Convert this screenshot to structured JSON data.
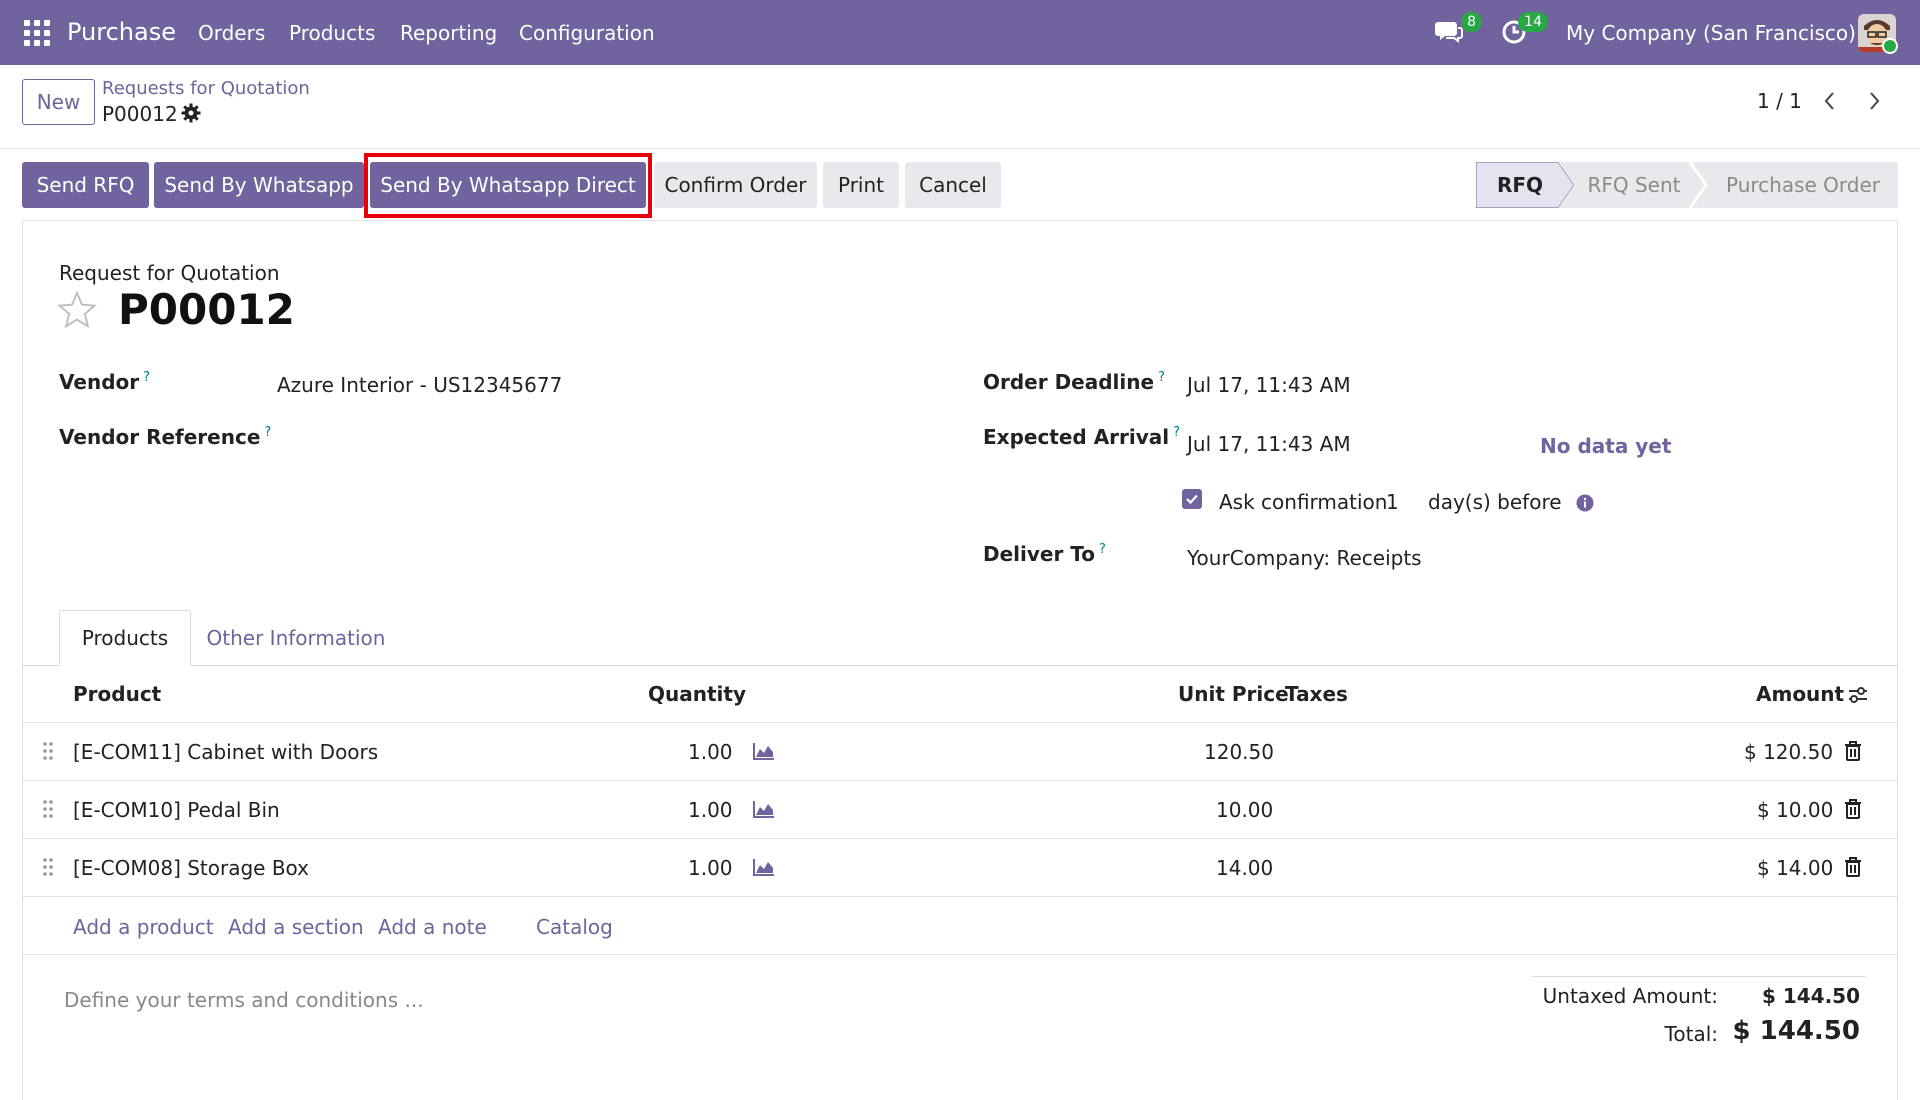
{
  "navbar": {
    "app_name": "Purchase",
    "menu": [
      "Orders",
      "Products",
      "Reporting",
      "Configuration"
    ],
    "messages_count": "8",
    "activities_count": "14",
    "company": "My Company (San Francisco)",
    "accent_color": "#71639e"
  },
  "control_panel": {
    "new_label": "New",
    "breadcrumb": "Requests for Quotation",
    "record_name": "P00012",
    "pager": "1 / 1"
  },
  "actions": {
    "send_rfq": "Send RFQ",
    "send_whatsapp": "Send By Whatsapp",
    "send_whatsapp_direct": "Send By Whatsapp Direct",
    "confirm_order": "Confirm Order",
    "print": "Print",
    "cancel": "Cancel"
  },
  "statusbar": {
    "steps": [
      "RFQ",
      "RFQ Sent",
      "Purchase Order"
    ],
    "active": "RFQ"
  },
  "form": {
    "doc_type": "Request for Quotation",
    "title": "P00012",
    "vendor_label": "Vendor",
    "vendor_value": "Azure Interior - US12345677",
    "vendor_ref_label": "Vendor Reference",
    "order_deadline_label": "Order Deadline",
    "order_deadline_value": "Jul 17, 11:43 AM",
    "expected_arrival_label": "Expected Arrival",
    "expected_arrival_value": "Jul 17, 11:43 AM",
    "no_data": "No data yet",
    "ask_confirmation_label": "Ask confirmation",
    "ask_confirmation_days": "1",
    "days_before": "day(s) before",
    "ask_confirmation_checked": true,
    "deliver_to_label": "Deliver To",
    "deliver_to_value": "YourCompany: Receipts",
    "help_mark": "?"
  },
  "tabs": [
    "Products",
    "Other Information"
  ],
  "table": {
    "headers": {
      "product": "Product",
      "quantity": "Quantity",
      "unit_price": "Unit Price",
      "taxes": "Taxes",
      "amount": "Amount"
    },
    "rows": [
      {
        "product": "[E-COM11] Cabinet with Doors",
        "quantity": "1.00",
        "unit_price": "120.50",
        "amount": "$ 120.50"
      },
      {
        "product": "[E-COM10] Pedal Bin",
        "quantity": "1.00",
        "unit_price": "10.00",
        "amount": "$ 10.00"
      },
      {
        "product": "[E-COM08] Storage Box",
        "quantity": "1.00",
        "unit_price": "14.00",
        "amount": "$ 14.00"
      }
    ],
    "add_links": [
      "Add a product",
      "Add a section",
      "Add a note",
      "Catalog"
    ]
  },
  "footer": {
    "terms_placeholder": "Define your terms and conditions ...",
    "untaxed_label": "Untaxed Amount:",
    "untaxed_value": "$ 144.50",
    "total_label": "Total:",
    "total_value": "$ 144.50"
  }
}
